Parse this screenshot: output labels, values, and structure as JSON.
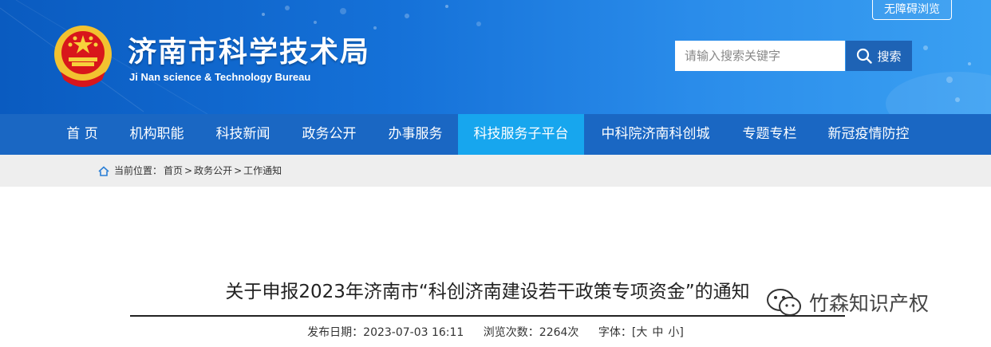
{
  "header": {
    "title": "济南市科学技术局",
    "subtitle": "Ji Nan science & Technology Bureau",
    "accessibility_label": "无障碍浏览",
    "search": {
      "placeholder": "请输入搜索关键字",
      "button_label": "搜索"
    }
  },
  "nav": {
    "items": [
      {
        "label": "首 页"
      },
      {
        "label": "机构职能"
      },
      {
        "label": "科技新闻"
      },
      {
        "label": "政务公开"
      },
      {
        "label": "办事服务"
      },
      {
        "label": "科技服务子平台",
        "active": true
      },
      {
        "label": "中科院济南科创城"
      },
      {
        "label": "专题专栏"
      },
      {
        "label": "新冠疫情防控"
      }
    ]
  },
  "breadcrumb": {
    "prefix": "当前位置：",
    "items": [
      "首页",
      "政务公开",
      "工作通知"
    ],
    "separator": ">"
  },
  "article": {
    "title": "关于申报2023年济南市“科创济南建设若干政策专项资金”的通知",
    "publish_label": "发布日期：",
    "publish_date": "2023-07-03 16:11",
    "views_label": "浏览次数：",
    "views": "2264次",
    "font_label": "字体：",
    "font_open": "[",
    "font_large": "大",
    "font_medium": "中",
    "font_small": "小",
    "font_close": "]"
  },
  "watermark": {
    "text": "竹森知识产权"
  },
  "colors": {
    "header_blue": "#1571d8",
    "nav_blue": "#1a67c3",
    "nav_active": "#17a6ee",
    "search_button": "#1e63b5",
    "crumb_bg": "#eeeeee"
  }
}
